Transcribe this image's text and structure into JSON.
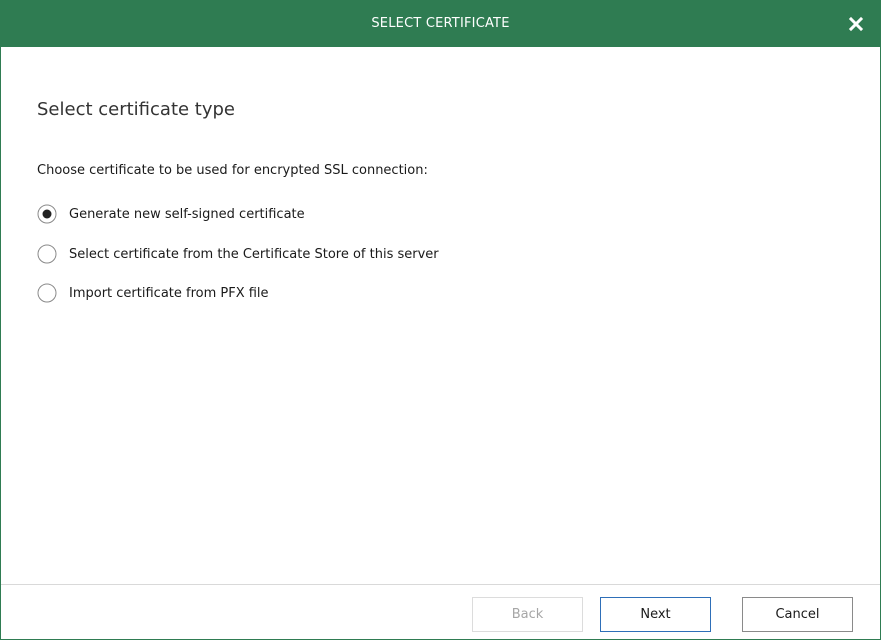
{
  "window": {
    "title": "SELECT CERTIFICATE",
    "close_icon": "close-icon",
    "title_bar_color": "#2f7c52"
  },
  "main": {
    "heading": "Select certificate type",
    "prompt": "Choose certificate to be used for encrypted SSL connection:",
    "options": [
      {
        "label": "Generate new self-signed certificate",
        "selected": true
      },
      {
        "label": "Select certificate from the Certificate Store of this server",
        "selected": false
      },
      {
        "label": "Import certificate from PFX file",
        "selected": false
      }
    ]
  },
  "footer": {
    "back_label": "Back",
    "back_enabled": false,
    "next_label": "Next",
    "cancel_label": "Cancel"
  }
}
